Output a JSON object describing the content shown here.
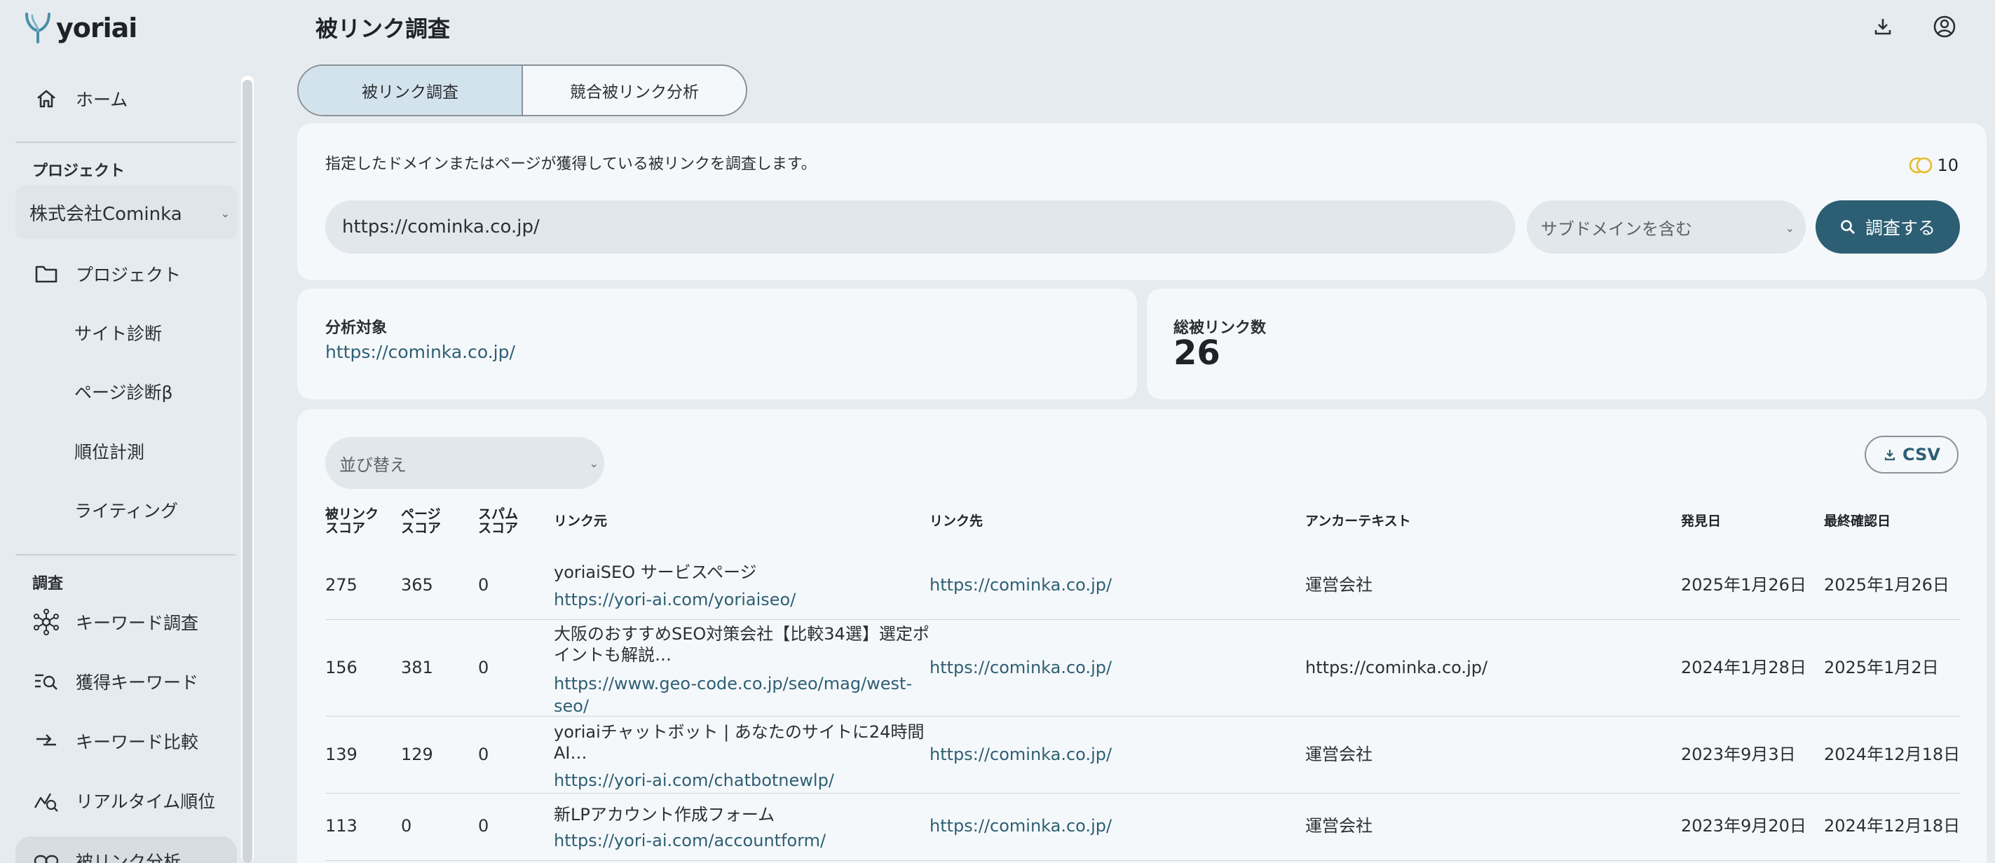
{
  "app": {
    "name": "yoriai"
  },
  "sidebar": {
    "home": "ホーム",
    "project_section": "プロジェクト",
    "project_select": "株式会社Cominka",
    "items": [
      {
        "label": "プロジェクト",
        "icon": "folder-icon"
      },
      {
        "label": "サイト診断"
      },
      {
        "label": "ページ診断β"
      },
      {
        "label": "順位計測"
      },
      {
        "label": "ライティング"
      }
    ],
    "research_section": "調査",
    "research_items": [
      {
        "label": "キーワード調査",
        "icon": "network-icon"
      },
      {
        "label": "獲得キーワード",
        "icon": "search-list-icon"
      },
      {
        "label": "キーワード比較",
        "icon": "compare-arrows-icon"
      },
      {
        "label": "リアルタイム順位",
        "icon": "realtime-chart-icon"
      },
      {
        "label": "被リンク分析",
        "icon": "link-icon"
      }
    ]
  },
  "header": {
    "title": "被リンク調査"
  },
  "tabs": [
    {
      "label": "被リンク調査",
      "active": true
    },
    {
      "label": "競合被リンク分析",
      "active": false
    }
  ],
  "search": {
    "description": "指定したドメインまたはページが獲得している被リンクを調査します。",
    "credits": "10",
    "url_value": "https://cominka.co.jp/",
    "scope_select": "サブドメインを含む",
    "button_label": "調査する"
  },
  "stats": {
    "target_label": "分析対象",
    "target_value": "https://cominka.co.jp/",
    "total_label": "総被リンク数",
    "total_value": "26"
  },
  "results": {
    "sort_placeholder": "並び替え",
    "csv_label": "CSV",
    "columns": {
      "backlink_score": "被リンク\nスコア",
      "page_score": "ページ\nスコア",
      "spam_score": "スパム\nスコア",
      "source": "リンク元",
      "target": "リンク先",
      "anchor": "アンカーテキスト",
      "found": "発見日",
      "last_checked": "最終確認日"
    },
    "rows": [
      {
        "backlink_score": "275",
        "page_score": "365",
        "spam_score": "0",
        "source_title": "yoriaiSEO サービスページ",
        "source_url": "https://yori-ai.com/yoriaiseo/",
        "target": "https://cominka.co.jp/",
        "anchor": "運営会社",
        "found": "2025年1月26日",
        "last_checked": "2025年1月26日"
      },
      {
        "backlink_score": "156",
        "page_score": "381",
        "spam_score": "0",
        "source_title": "大阪のおすすめSEO対策会社【比較34選】選定ポイントも解説…",
        "source_url": "https://www.geo-code.co.jp/seo/mag/west-seo/",
        "target": "https://cominka.co.jp/",
        "anchor": "https://cominka.co.jp/",
        "found": "2024年1月28日",
        "last_checked": "2025年1月2日"
      },
      {
        "backlink_score": "139",
        "page_score": "129",
        "spam_score": "0",
        "source_title": "yoriaiチャットボット | あなたのサイトに24時間AI…",
        "source_url": "https://yori-ai.com/chatbotnewlp/",
        "target": "https://cominka.co.jp/",
        "anchor": "運営会社",
        "found": "2023年9月3日",
        "last_checked": "2024年12月18日"
      },
      {
        "backlink_score": "113",
        "page_score": "0",
        "spam_score": "0",
        "source_title": "新LPアカウント作成フォーム",
        "source_url": "https://yori-ai.com/accountform/",
        "target": "https://cominka.co.jp/",
        "anchor": "運営会社",
        "found": "2023年9月20日",
        "last_checked": "2024年12月18日"
      }
    ]
  }
}
